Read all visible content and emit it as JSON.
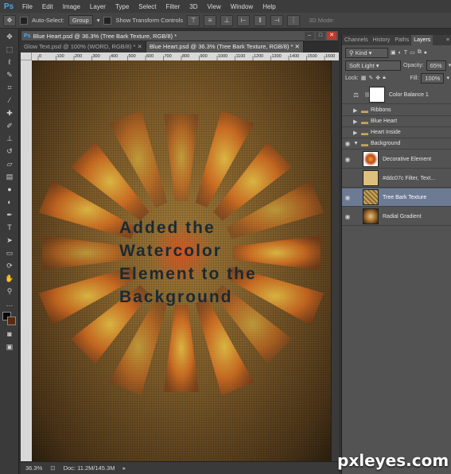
{
  "menubar": {
    "logo": "Ps",
    "items": [
      "File",
      "Edit",
      "Image",
      "Layer",
      "Type",
      "Select",
      "Filter",
      "3D",
      "View",
      "Window",
      "Help"
    ]
  },
  "options": {
    "auto_select_label": "Auto-Select:",
    "auto_select_value": "Group",
    "show_transform_label": "Show Transform Controls",
    "mode_3d_label": "3D Mode:"
  },
  "document": {
    "window_title": "Blue Heart.psd @ 36.3% (Tree Bark Texture, RGB/8) *",
    "tabs": [
      {
        "label": "Glow Text.psd @ 100% (WORD, RGB/8) *",
        "active": false
      },
      {
        "label": "Blue Heart.psd @ 36.3% (Tree Bark Texture, RGB/8) *",
        "active": true
      }
    ],
    "ruler_ticks": [
      "0",
      "100",
      "200",
      "300",
      "400",
      "500",
      "600",
      "700",
      "800",
      "900",
      "1000",
      "1100",
      "1200",
      "1300",
      "1400",
      "1500",
      "1600"
    ],
    "canvas_text": [
      "Added the",
      "Watercolor",
      "Element to the",
      "Background"
    ],
    "status": {
      "zoom": "36.3%",
      "doc": "Doc: 11.2M/145.3M"
    }
  },
  "layers_panel": {
    "tabs": [
      "Channels",
      "History",
      "Paths",
      "Layers"
    ],
    "active_tab": "Layers",
    "kind_label": "Kind",
    "blend_mode": "Soft Light",
    "opacity_label": "Opacity:",
    "opacity_value": "65%",
    "lock_label": "Lock:",
    "fill_label": "Fill:",
    "fill_value": "100%",
    "layers": [
      {
        "name": "Color Balance 1",
        "type": "adjustment",
        "visible": false
      },
      {
        "name": "Ribbons",
        "type": "group",
        "visible": false
      },
      {
        "name": "Blue Heart",
        "type": "group",
        "visible": false
      },
      {
        "name": "Heart Inside",
        "type": "group",
        "visible": false
      },
      {
        "name": "Background",
        "type": "group",
        "visible": true,
        "expanded": true
      },
      {
        "name": "Decorative Element",
        "type": "layer",
        "visible": true
      },
      {
        "name": "#ddc07c  Filter, Text...",
        "type": "layer",
        "visible": false
      },
      {
        "name": "Tree Bark Texture",
        "type": "layer",
        "visible": true,
        "selected": true
      },
      {
        "name": "Radial Gradient",
        "type": "layer",
        "visible": true
      }
    ]
  },
  "watermark": "pxleyes.com",
  "colors": {
    "selection": "#6c7a94",
    "ps_blue": "#4fa6e8",
    "canvas_text": "#1b2a33"
  },
  "decoration": {
    "sunburst_rays": 16
  }
}
